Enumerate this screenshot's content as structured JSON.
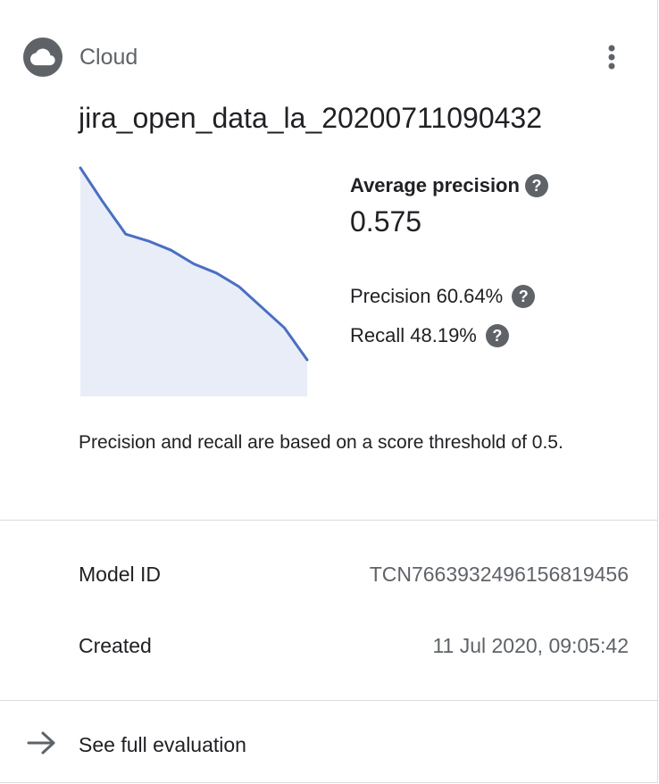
{
  "header": {
    "icon": "cloud-icon",
    "label": "Cloud",
    "menu_icon": "more-vert-icon"
  },
  "model": {
    "name": "jira_open_data_la_20200711090432"
  },
  "metrics": {
    "average_precision_label": "Average precision",
    "average_precision_value": "0.575",
    "precision_label": "Precision 60.64%",
    "recall_label": "Recall 48.19%",
    "help_glyph": "?",
    "threshold_note": "Precision and recall are based on a score threshold of 0.5."
  },
  "details": [
    {
      "key": "Model ID",
      "value": "TCN7663932496156819456"
    },
    {
      "key": "Created",
      "value": "11 Jul 2020, 09:05:42"
    }
  ],
  "footer": {
    "icon": "arrow-right-icon",
    "link_label": "See full evaluation"
  },
  "colors": {
    "curve_line": "#4a6fc1",
    "curve_fill": "#e8edf8",
    "icon_grey": "#5f6368",
    "divider": "#dadce0"
  },
  "chart_data": {
    "type": "area",
    "x": [
      0.0,
      0.1,
      0.2,
      0.3,
      0.4,
      0.5,
      0.6,
      0.7,
      0.8,
      0.9,
      0.95,
      1.0
    ],
    "y": [
      1.0,
      0.85,
      0.71,
      0.68,
      0.64,
      0.58,
      0.54,
      0.48,
      0.39,
      0.3,
      0.23,
      0.16
    ],
    "xlim": [
      0,
      1
    ],
    "ylim": [
      0,
      1
    ],
    "title": "",
    "xlabel": "",
    "ylabel": "",
    "grid": false
  }
}
